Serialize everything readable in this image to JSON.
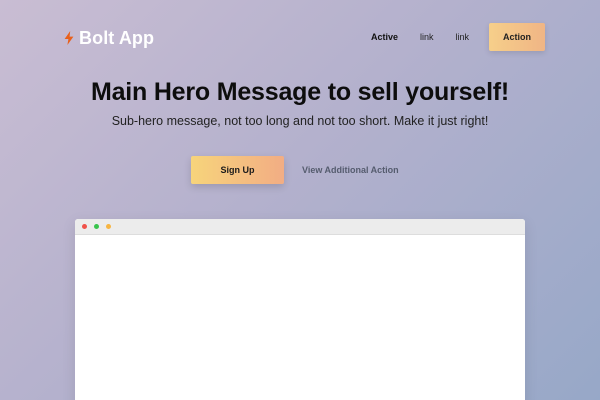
{
  "brand": {
    "name": "Bolt App",
    "icon": "lightning-bolt-icon",
    "icon_color": "#e8601c"
  },
  "nav": {
    "links": [
      {
        "label": "Active",
        "active": true
      },
      {
        "label": "link",
        "active": false
      },
      {
        "label": "link",
        "active": false
      }
    ],
    "action_label": "Action"
  },
  "hero": {
    "title": "Main Hero Message to sell yourself!",
    "subtitle": "Sub-hero message, not too long and not too short. Make it just right!",
    "primary_cta": "Sign Up",
    "secondary_cta": "View Additional Action"
  },
  "mock_window": {
    "dots": [
      {
        "name": "close-dot",
        "color": "#f0524a"
      },
      {
        "name": "maximize-dot",
        "color": "#39c44d"
      },
      {
        "name": "minimize-dot",
        "color": "#f7b543"
      }
    ]
  },
  "colors": {
    "accent_gradient_start": "#f7d47b",
    "accent_gradient_end": "#f2ad84",
    "background_start": "#c9bdd3",
    "background_end": "#97a8c8"
  }
}
